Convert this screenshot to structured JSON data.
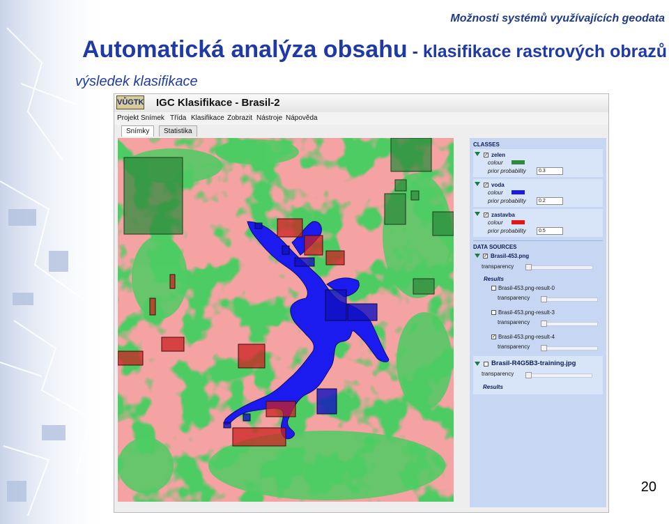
{
  "slide": {
    "header_top": "Možnosti systémů využívajících geodata",
    "title_main": "Automatická analýza obsahu",
    "title_sub": " - klasifikace rastrových obrazů",
    "subtitle": "výsledek klasifikace",
    "page_number": "20"
  },
  "app": {
    "logo_text": "VŮGTK",
    "title": "IGC Klasifikace - Brasil-2",
    "menu": [
      "Projekt",
      "Snímek",
      "Třída",
      "Klasifikace",
      "Zobrazit",
      "Nástroje",
      "Nápověda"
    ],
    "tabs": [
      {
        "label": "Snímky",
        "active": true
      },
      {
        "label": "Statistika",
        "active": false
      }
    ]
  },
  "classes_panel": {
    "heading": "CLASSES",
    "colour_label": "colour",
    "prior_label": "prior probability",
    "classes": [
      {
        "name": "zelen",
        "color": "#2e8b3e",
        "prior": "0.3",
        "checked": true
      },
      {
        "name": "voda",
        "color": "#1a1ae6",
        "prior": "0.2",
        "checked": true
      },
      {
        "name": "zastavba",
        "color": "#e01818",
        "prior": "0.5",
        "checked": true
      }
    ]
  },
  "data_sources": {
    "heading": "DATA SOURCES",
    "transparency_label": "transparency",
    "results_label": "Results",
    "source1": {
      "name": "Brasil-453.png",
      "checked": true
    },
    "results": [
      {
        "name": "Brasil-453.png-result-0",
        "checked": false
      },
      {
        "name": "Brasil-453.png-result-3",
        "checked": false
      },
      {
        "name": "Brasil-453.png-result-4",
        "checked": true
      }
    ],
    "source2": {
      "name": "Brasil-R4G5B3-training.jpg",
      "checked": false
    }
  },
  "colors": {
    "title_blue": "#1f3aa5",
    "green": "#47c961",
    "pink": "#f29b9b",
    "water": "#1b1bf0",
    "training_green": "#2f8a3c",
    "training_red": "#cc2020",
    "panel_bg": "#c7d7f3"
  }
}
